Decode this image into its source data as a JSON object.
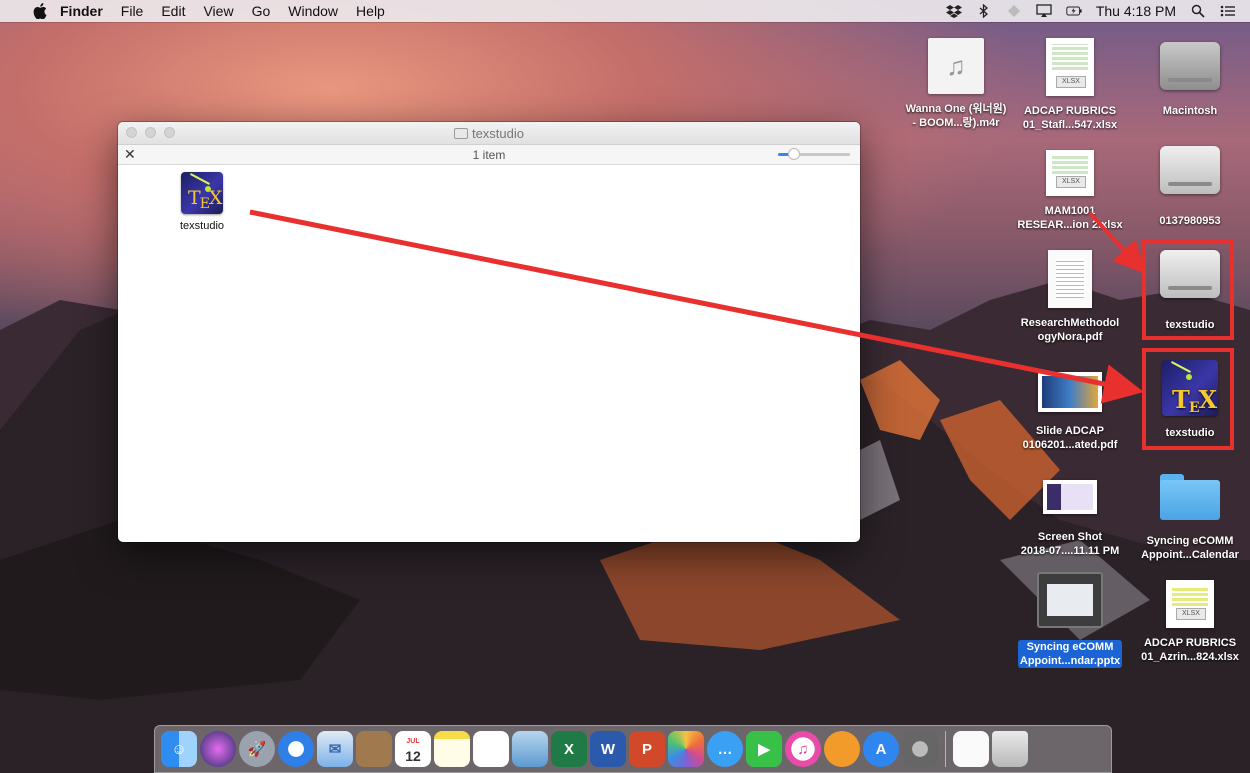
{
  "menubar": {
    "app_name": "Finder",
    "menus": [
      "File",
      "Edit",
      "View",
      "Go",
      "Window",
      "Help"
    ],
    "clock": "Thu 4:18 PM",
    "status_icons": [
      "dropbox-icon",
      "bluetooth-icon",
      "vpn-icon",
      "airplay-icon",
      "battery-icon",
      "spotlight-icon",
      "notification-center-icon"
    ]
  },
  "finder_window": {
    "title": "texstudio",
    "status": "1 item",
    "items": [
      {
        "name": "texstudio",
        "icon": "texstudio-app-icon"
      }
    ]
  },
  "desktop": {
    "icons": [
      {
        "id": "wanna-one",
        "label": "Wanna One (워너원)\n- BOOM...랑).m4r",
        "kind": "music"
      },
      {
        "id": "adcap-1",
        "label": "ADCAP RUBRICS\n01_Stafl...547.xlsx",
        "kind": "xlsx",
        "tag": "XLSX"
      },
      {
        "id": "macintosh",
        "label": "Macintosh",
        "kind": "hdd"
      },
      {
        "id": "mam1001",
        "label": "MAM1001\nRESEAR...ion 2.xlsx",
        "kind": "xlsx",
        "tag": "XLSX"
      },
      {
        "id": "disk-0137980953",
        "label": "0137980953",
        "kind": "disk"
      },
      {
        "id": "research-pdf",
        "label": "ResearchMethodol\nogyNora.pdf",
        "kind": "pdf"
      },
      {
        "id": "texstudio-disk",
        "label": "texstudio",
        "kind": "disk"
      },
      {
        "id": "slide-adcap",
        "label": "Slide ADCAP\n0106201...ated.pdf",
        "kind": "slide"
      },
      {
        "id": "texstudio-app",
        "label": "texstudio",
        "kind": "tex"
      },
      {
        "id": "screenshot",
        "label": "Screen Shot\n2018-07....11.11 PM",
        "kind": "screenshot"
      },
      {
        "id": "syncing-folder",
        "label": "Syncing eCOMM\nAppoint...Calendar",
        "kind": "folder"
      },
      {
        "id": "syncing-pptx",
        "label": "Syncing eCOMM\nAppoint...ndar.pptx",
        "kind": "pptx",
        "selected": true
      },
      {
        "id": "adcap-2",
        "label": "ADCAP RUBRICS\n01_Azrin...824.xlsx",
        "kind": "xlsx",
        "tag": "XLSX"
      }
    ]
  },
  "dock": {
    "calendar_date": "12",
    "calendar_month": "JUL",
    "apps": [
      "Finder",
      "Siri",
      "Launchpad",
      "Safari",
      "Mail",
      "Contacts",
      "Calendar",
      "Notes",
      "Reminders",
      "Preview",
      "Excel",
      "Word",
      "PowerPoint",
      "Photos",
      "Messages",
      "FaceTime",
      "iTunes",
      "iBooks",
      "App Store",
      "System Preferences",
      "Documents",
      "Trash"
    ]
  },
  "colors": {
    "annotation_red": "#e8302e",
    "selection_blue": "#1a64d6",
    "slider_blue": "#3a83f7"
  }
}
